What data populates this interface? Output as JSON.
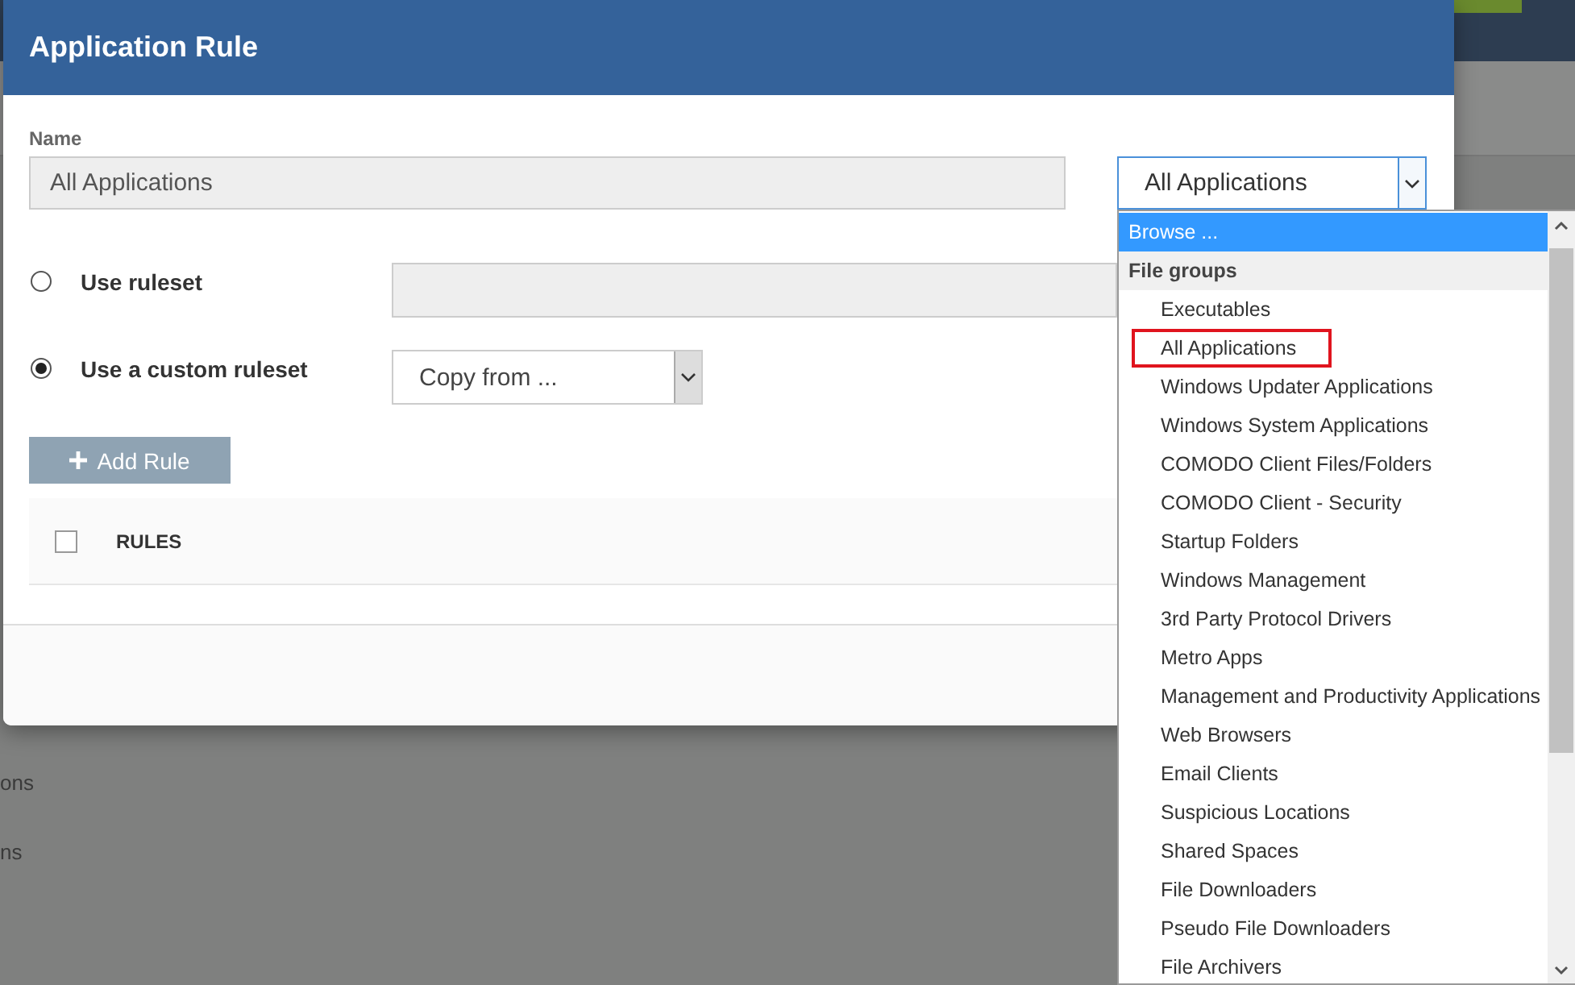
{
  "background": {
    "texts": [
      "ons",
      "ns"
    ]
  },
  "dialog": {
    "title": "Application Rule",
    "name_label": "Name",
    "name_value": "All Applications",
    "source_value": "All Applications",
    "ruleset_options": [
      {
        "label": "Use ruleset",
        "selected": false
      },
      {
        "label": "Use a custom ruleset",
        "selected": true
      }
    ],
    "copy_from": "Copy from ...",
    "add_button": "Add Rule",
    "table": {
      "checked": false,
      "column": "RULES"
    }
  },
  "dropdown": {
    "items": [
      {
        "kind": "option",
        "label": "Browse ...",
        "selected": true,
        "outlined": false
      },
      {
        "kind": "group",
        "label": "File groups",
        "selected": false,
        "outlined": false
      },
      {
        "kind": "option",
        "label": "Executables",
        "selected": false,
        "outlined": false
      },
      {
        "kind": "option",
        "label": "All Applications",
        "selected": false,
        "outlined": true
      },
      {
        "kind": "option",
        "label": "Windows Updater Applications",
        "selected": false,
        "outlined": false
      },
      {
        "kind": "option",
        "label": "Windows System Applications",
        "selected": false,
        "outlined": false
      },
      {
        "kind": "option",
        "label": "COMODO Client Files/Folders",
        "selected": false,
        "outlined": false
      },
      {
        "kind": "option",
        "label": "COMODO Client - Security",
        "selected": false,
        "outlined": false
      },
      {
        "kind": "option",
        "label": "Startup Folders",
        "selected": false,
        "outlined": false
      },
      {
        "kind": "option",
        "label": "Windows Management",
        "selected": false,
        "outlined": false
      },
      {
        "kind": "option",
        "label": "3rd Party Protocol Drivers",
        "selected": false,
        "outlined": false
      },
      {
        "kind": "option",
        "label": "Metro Apps",
        "selected": false,
        "outlined": false
      },
      {
        "kind": "option",
        "label": "Management and Productivity Applications",
        "selected": false,
        "outlined": false
      },
      {
        "kind": "option",
        "label": "Web Browsers",
        "selected": false,
        "outlined": false
      },
      {
        "kind": "option",
        "label": "Email Clients",
        "selected": false,
        "outlined": false
      },
      {
        "kind": "option",
        "label": "Suspicious Locations",
        "selected": false,
        "outlined": false
      },
      {
        "kind": "option",
        "label": "Shared Spaces",
        "selected": false,
        "outlined": false
      },
      {
        "kind": "option",
        "label": "File Downloaders",
        "selected": false,
        "outlined": false
      },
      {
        "kind": "option",
        "label": "Pseudo File Downloaders",
        "selected": false,
        "outlined": false
      },
      {
        "kind": "option",
        "label": "File Archivers",
        "selected": false,
        "outlined": false
      }
    ]
  }
}
